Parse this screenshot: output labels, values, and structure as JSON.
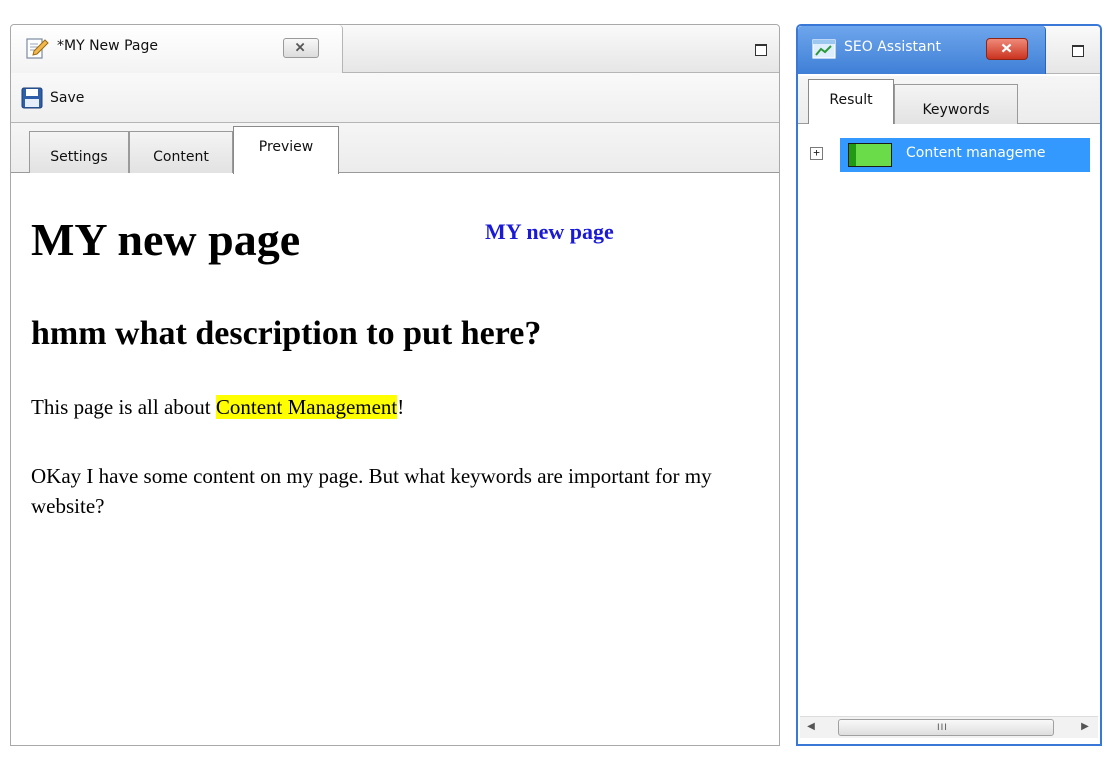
{
  "editor": {
    "tab_title": "*MY New Page",
    "toolbar": {
      "save_label": "Save"
    },
    "subtabs": [
      {
        "label": "Settings",
        "active": false
      },
      {
        "label": "Content",
        "active": false
      },
      {
        "label": "Preview",
        "active": true
      }
    ],
    "preview": {
      "heading": "MY new page",
      "side_link": "MY new page",
      "subheading": "hmm what description to put here?",
      "paragraph1_before": "This page is all about ",
      "paragraph1_highlight": "Content Management",
      "paragraph1_after": "!",
      "paragraph2": "OKay I have some content on my page. But what keywords are important for my website?"
    }
  },
  "seo_panel": {
    "tab_title": "SEO Assistant",
    "subtabs": [
      {
        "label": "Result",
        "active": true
      },
      {
        "label": "Keywords",
        "active": false
      }
    ],
    "tree": [
      {
        "label": "Content manageme",
        "expander": "+",
        "score_fraction": 1.0,
        "selected": true
      }
    ],
    "scrollbar_grip": "III"
  },
  "colors": {
    "seo_accent": "#3a78d8",
    "selection": "#3399ff",
    "highlight": "#ffff00",
    "link": "#1a1ad6",
    "score_green": "#6adc4a"
  },
  "icons": [
    "document-edit-icon",
    "close-icon",
    "maximize-icon",
    "save-disk-icon",
    "seo-app-icon",
    "close-red-icon",
    "expand-plus-icon",
    "scroll-left-arrow-icon",
    "scroll-right-arrow-icon"
  ]
}
